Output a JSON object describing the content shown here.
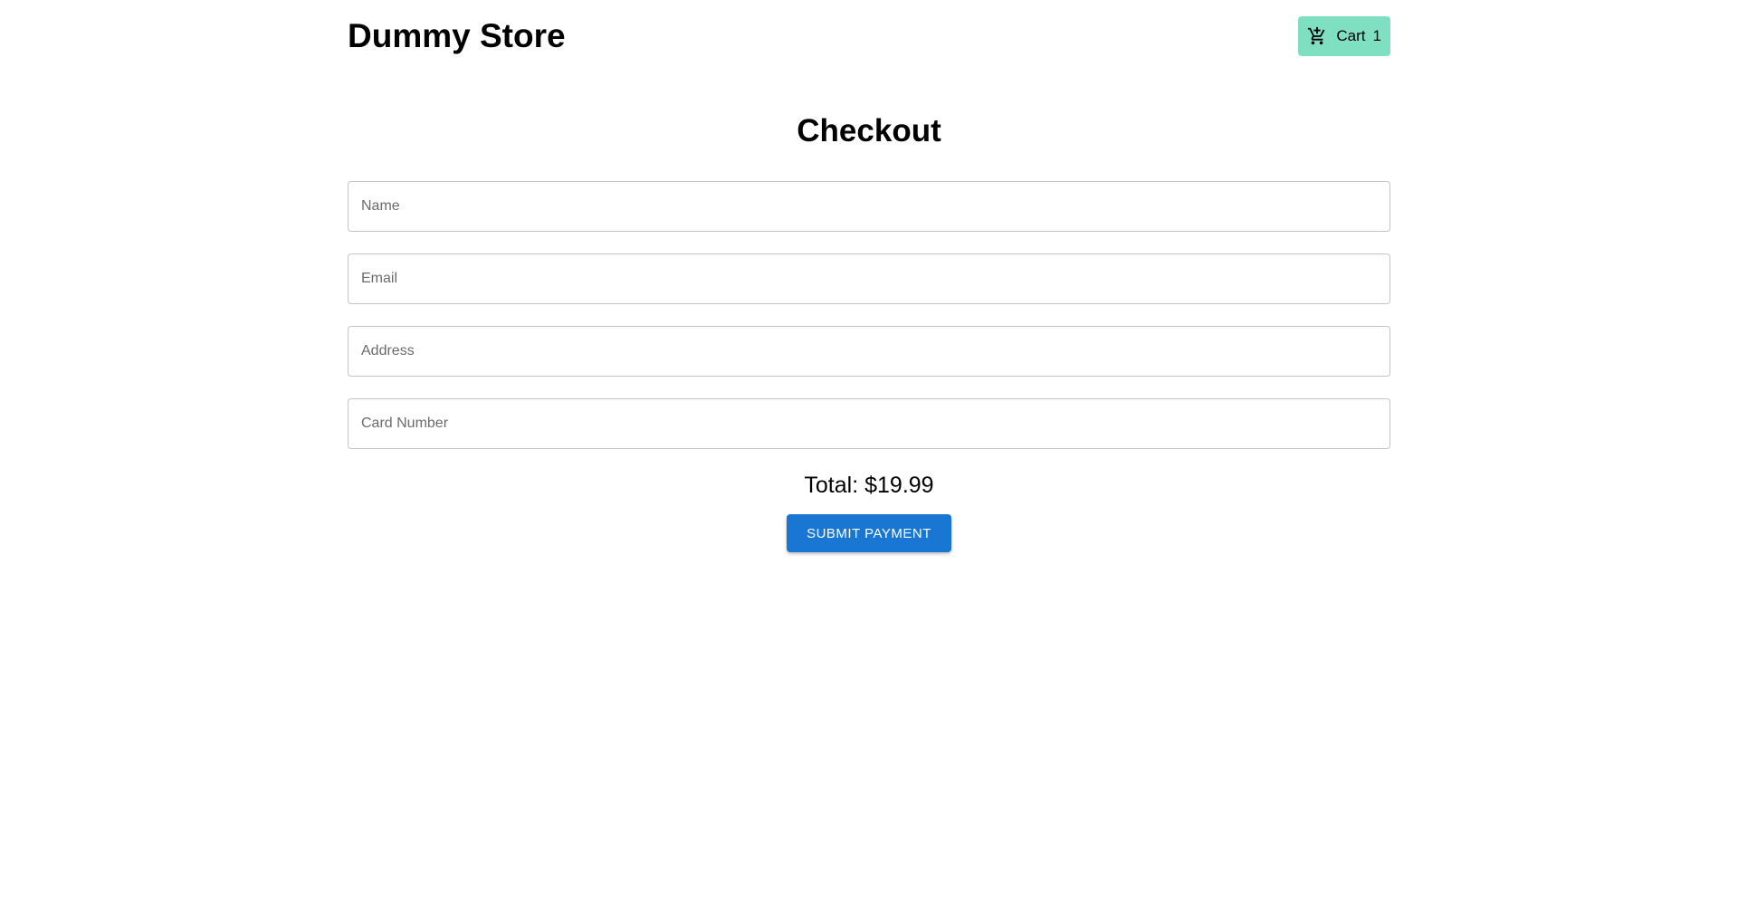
{
  "header": {
    "title": "Dummy Store",
    "cart": {
      "icon": "cart-icon",
      "label": "Cart",
      "count": "1",
      "background": "#7fe0c1"
    }
  },
  "checkout": {
    "title": "Checkout",
    "fields": {
      "name_placeholder": "Name",
      "email_placeholder": "Email",
      "address_placeholder": "Address",
      "card_placeholder": "Card Number"
    },
    "total": "Total: $19.99",
    "submit_label": "SUBMIT PAYMENT",
    "submit_color": "#1976d2"
  }
}
